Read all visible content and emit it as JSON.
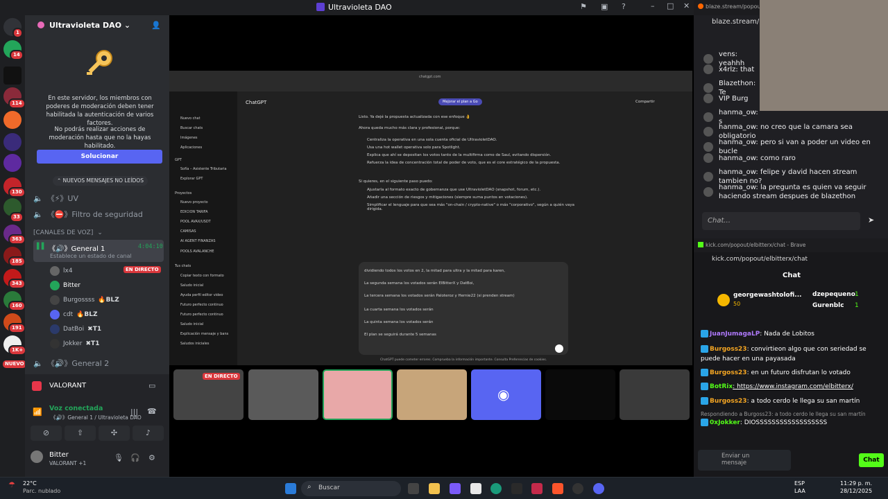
{
  "window": {
    "title": "Ultravioleta DAO"
  },
  "server": {
    "name": "Ultravioleta DAO",
    "mfa_notice": "En este servidor, los miembros con poderes de moderación deben tener habilitada la autenticación de varios factores.",
    "mfa_notice2": "No podrás realizar acciones de moderación hasta que no la hayas habilitado.",
    "fix_button": "Solucionar",
    "new_messages": "NUEVOS MENSAJES NO LEÍDOS",
    "channels": [
      {
        "label": "《⚡》UV"
      },
      {
        "label": "《⛔》Filtro de seguridad"
      }
    ],
    "voice_category": "[CANALES DE VOZ]",
    "voice_channel": "《🔊》General 1",
    "voice_timer": "4:04:10",
    "voice_status": "Establece un estado de canal",
    "members": [
      {
        "name": "lx4",
        "live": "EN DIRECTO"
      },
      {
        "name": "Bitter"
      },
      {
        "name": "Burgossss",
        "tag": "🔥BLZ"
      },
      {
        "name": "cdt",
        "tag": "🔥BLZ"
      },
      {
        "name": "DatBoi",
        "tag": "✖T1"
      },
      {
        "name": "Jokker",
        "tag": "✖T1"
      }
    ],
    "voice_channel2": "《🔊》General 2",
    "activity": "VALORANT",
    "voice_connected": "Voz conectada",
    "voice_location": "《🔊》General 1 / Ultravioleta DAO",
    "user": {
      "name": "Bitter",
      "status": "VALORANT +1"
    },
    "rail_badges": [
      "1",
      "14",
      "114",
      "1",
      "363",
      "185",
      "343",
      "160",
      "191",
      "1K+",
      "NUEVO",
      "130",
      "33"
    ]
  },
  "chatgpt": {
    "title": "ChatGPT",
    "upgrade": "Mejorar el plan a Go",
    "share": "Compartir",
    "url": "chatgpt.com",
    "side": [
      "Nuevo chat",
      "Buscar chats",
      "Imágenes",
      "Aplicaciones",
      "GPT",
      "Sofía – Asistente Tributaria",
      "Explorar GPT",
      "Proyectos",
      "Nuevo proyecto",
      "EDICION TARIFA",
      "POOL AVAX/USDT",
      "CAMISAS",
      "AI AGENT FINANZAS",
      "POOLS AVALANCHE",
      "Tus chats",
      "Copiar texto con formato",
      "Saludo inicial",
      "Ayuda perfil editor video",
      "Futuro perfecto continuo",
      "Futuro perfecto continuo",
      "Saludo inicial",
      "Explicación mensaje y bans",
      "Saludos iniciales"
    ],
    "messages": [
      "Listo. Ya dejé la propuesta actualizada con ese enfoque 👌",
      "Ahora queda mucho más clara y profesional, porque:",
      "Centraliza la operativa en una sola cuenta oficial de UltravioletDAO.",
      "Usa una hot wallet operativa solo para Spotlight.",
      "Explica que ahí se depositan los votos tanto de la multifirma como de Saul, evitando dispersión.",
      "Refuerza la idea de concentración total de poder de voto, que es el core estratégico de la propuesta.",
      "Si quieres, en el siguiente paso puedo:",
      "Ajustarla al formato exacto de gobernanza que use UltravioletDAO (snapshot, forum, etc.).",
      "Añadir una sección de riesgos y mitigaciones (siempre suma puntos en votaciones).",
      "Simplificar el lenguaje para que sea más \"on-chain / crypto-native\" o más \"corporativo\", según a quién vaya dirigida."
    ],
    "input": [
      "dividiendo todos los votos en 2, la mitad para ultra y la mitad para karen,",
      "La segunda semana los votados serán ElBitterX y DatBoi,",
      "La tercera semana los votados serán Paloteroz y Hernie22 (si prenden stream)",
      "La cuarta semana los votados serán",
      "La quinta semana los votados serán",
      "El plan se seguirá durante 5 semanas"
    ],
    "footer": "ChatGPT puede cometer errores. Comprueba la información importante. Consulta Preferencias de cookies."
  },
  "stream_tiles": {
    "live": "EN DIRECTO"
  },
  "blaze": {
    "url": "blaze.stream/popout",
    "url2": "blaze.stream/pop",
    "messages": [
      {
        "user": "vens",
        "text": "yeahhh"
      },
      {
        "user": "x4rlz",
        "text": "that"
      },
      {
        "user": "Blazethon",
        "text": "Te"
      },
      {
        "user": "VIP Burg",
        "text": ""
      },
      {
        "user": "hanma_ow",
        "text": "s"
      },
      {
        "user": "hanma_ow",
        "text": "no creo que la camara sea obligatorio"
      },
      {
        "user": "hanma_ow",
        "text": "pero si van a poder un video en bucle"
      },
      {
        "user": "hanma_ow",
        "text": "como raro"
      },
      {
        "user": "hanma_ow",
        "text": "felipe y david hacen stream tambien no?"
      },
      {
        "user": "hanma_ow",
        "text": "la pregunta es quien va seguir haciendo stream despues de blazethon"
      }
    ],
    "placeholder": "Chat..."
  },
  "kick": {
    "window_title": "kick.com/popout/elbitterx/chat - Brave",
    "url": "kick.com/popout/elbitterx/chat",
    "header": "Chat",
    "gifters": [
      {
        "name": "georgewashtolofi...",
        "count": "50"
      },
      {
        "name": "dzepequeno",
        "count": "1"
      },
      {
        "name": "Gurenblc",
        "count": "1"
      }
    ],
    "messages": [
      {
        "user": "JuanJumagaLP",
        "text": "Nada de Lobitos",
        "color": "#b07aff"
      },
      {
        "user": "Burgoss23",
        "text": "convirtieon algo que con seriedad se puede hacer en una payasada",
        "color": "#f5a623"
      },
      {
        "user": "Burgoss23",
        "text": "en un futuro disfrutan lo votado",
        "color": "#f5a623"
      },
      {
        "user": "BotRix",
        "text": "https://www.instagram.com/elbitterx/",
        "color": "#53fc18"
      },
      {
        "user": "Burgoss23",
        "text": "a todo cerdo le llega su san martín",
        "color": "#f5a623"
      },
      {
        "user": "0xJokker",
        "text": "DIOSSSSSSSSSSSSSSSSSS",
        "color": "#53fc18"
      }
    ],
    "reply": "Respondiendo a Burgoss23: a todo cerdo le llega su san martín",
    "placeholder": "Enviar un mensaje",
    "send": "Chat"
  },
  "taskbar": {
    "weather_temp": "22°C",
    "weather_desc": "Parc. nublado",
    "search": "Buscar",
    "lang": "ESP",
    "lang2": "LAA",
    "time": "11:29 p. m.",
    "date": "28/12/2025"
  }
}
